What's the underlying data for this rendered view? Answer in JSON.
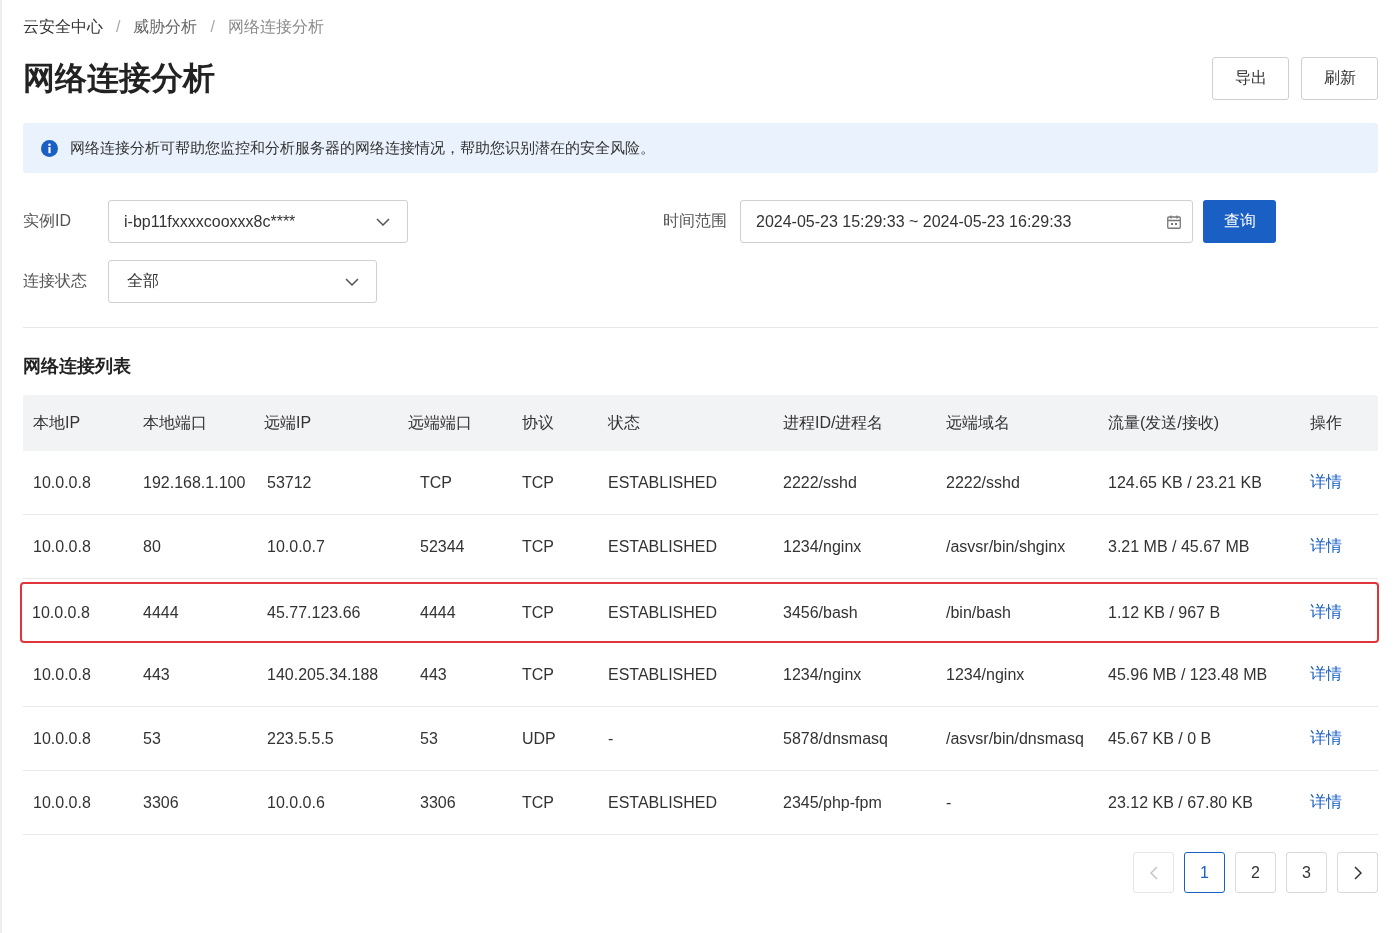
{
  "breadcrumb": {
    "items": [
      {
        "label": "云安全中心",
        "current": false
      },
      {
        "label": "威胁分析",
        "current": false
      },
      {
        "label": "网络连接分析",
        "current": true
      }
    ],
    "separators": [
      "/",
      "/"
    ]
  },
  "page_title": "网络连接分析",
  "header_buttons": [
    "导出",
    "刷新"
  ],
  "info_alert": {
    "text": "网络连接分析可帮助您监控和分析服务器的网络连接情况，帮助您识别潜在的安全风险。"
  },
  "filters": {
    "instance": {
      "label": "实例ID",
      "value": "i-bp11fxxxxcooxxx8c****"
    },
    "time_range": {
      "label": "时间范围",
      "value": "2024-05-23 15:29:33 ~ 2024-05-23 16:29:33"
    },
    "query_button": "查询",
    "status": {
      "label": "连接状态",
      "value": "全部"
    }
  },
  "section_title": "网络连接列表",
  "table": {
    "columns": [
      "本地IP",
      "本地端口",
      "远端IP",
      "远端端口",
      "协议",
      "状态",
      "进程ID/进程名",
      "远端域名",
      "流量(发送/接收)",
      "操作"
    ],
    "rows": [
      {
        "cells": [
          "10.0.0.8",
          "192.168.1.100",
          "53712",
          "TCP",
          "TCP",
          "ESTABLISHED",
          "2222/sshd",
          "2222/sshd",
          "124.65 KB / 23.21 KB"
        ],
        "action": "详情",
        "highlighted": false
      },
      {
        "cells": [
          "10.0.0.8",
          "80",
          "10.0.0.7",
          "52344",
          "TCP",
          "ESTABLISHED",
          "1234/nginx",
          "/asvsr/bin/shginx",
          "3.21 MB / 45.67 MB"
        ],
        "action": "详情",
        "highlighted": false
      },
      {
        "cells": [
          "10.0.0.8",
          "4444",
          "45.77.123.66",
          "4444",
          "TCP",
          "ESTABLISHED",
          "3456/bash",
          "/bin/bash",
          "1.12 KB / 967 B"
        ],
        "action": "详情",
        "highlighted": true
      },
      {
        "cells": [
          "10.0.0.8",
          "443",
          "140.205.34.188",
          "443",
          "TCP",
          "ESTABLISHED",
          "1234/nginx",
          "1234/nginx",
          "45.96 MB / 123.48 MB"
        ],
        "action": "详情",
        "highlighted": false
      },
      {
        "cells": [
          "10.0.0.8",
          "53",
          "223.5.5.5",
          "53",
          "UDP",
          "-",
          "5878/dnsmasq",
          "/asvsr/bin/dnsmasq",
          "45.67 KB / 0 B"
        ],
        "action": "详情",
        "highlighted": false
      },
      {
        "cells": [
          "10.0.0.8",
          "3306",
          "10.0.0.6",
          "3306",
          "TCP",
          "ESTABLISHED",
          "2345/php-fpm",
          "-",
          "23.12 KB / 67.80 KB"
        ],
        "action": "详情",
        "highlighted": false
      }
    ]
  },
  "pagination": {
    "prev": {
      "disabled": true
    },
    "pages": [
      {
        "label": "1",
        "selected": true
      },
      {
        "label": "2",
        "selected": false
      },
      {
        "label": "3",
        "selected": false
      }
    ],
    "next": {
      "disabled": false
    }
  }
}
